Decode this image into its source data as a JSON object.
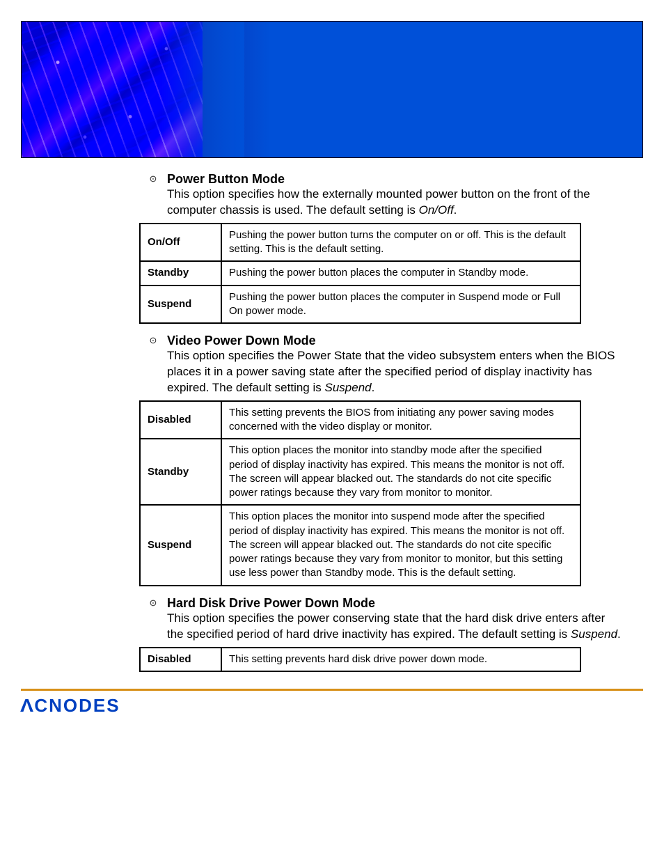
{
  "brand": "CNODES",
  "sections": [
    {
      "title": "Power Button Mode",
      "body_pre": "This option specifies how the externally mounted power button on the front of the computer chassis is used. The default setting is ",
      "body_em": "On/Off",
      "body_post": ".",
      "rows": [
        {
          "label": "On/Off",
          "desc": "Pushing the power button turns the computer on or off. This is the default setting. This is the default setting."
        },
        {
          "label": "Standby",
          "desc": "Pushing the power button places the computer in Standby mode."
        },
        {
          "label": "Suspend",
          "desc": "Pushing the power button places the computer in Suspend mode or Full On power mode."
        }
      ]
    },
    {
      "title": "Video Power Down Mode",
      "body_pre": "This option specifies the Power State that the video subsystem enters when the BIOS places it in a power saving state after the specified period of display inactivity has expired. The default setting is ",
      "body_em": "Suspend",
      "body_post": ".",
      "rows": [
        {
          "label": "Disabled",
          "desc": "This setting prevents the BIOS from initiating any power saving modes concerned with the video display or monitor."
        },
        {
          "label": "Standby",
          "desc": "This option places the monitor into standby mode after the specified period of display inactivity has expired. This means the monitor is not off. The screen will appear blacked out. The standards do not cite specific power ratings because they vary from monitor to monitor."
        },
        {
          "label": "Suspend",
          "desc": "This option places the monitor into suspend mode after the specified period of display inactivity has expired. This means the monitor is not off. The screen will appear blacked out. The standards do not cite specific power ratings because they vary from monitor to monitor, but this setting use less power than Standby mode. This is the default setting."
        }
      ]
    },
    {
      "title": "Hard Disk Drive Power Down Mode",
      "body_pre": "This option specifies the power conserving state that the hard disk drive enters after the specified period of hard drive inactivity has expired. The default setting is ",
      "body_em": "Suspend",
      "body_post": ".",
      "rows": [
        {
          "label": "Disabled",
          "desc": "This setting prevents hard disk drive power down mode."
        }
      ]
    }
  ]
}
